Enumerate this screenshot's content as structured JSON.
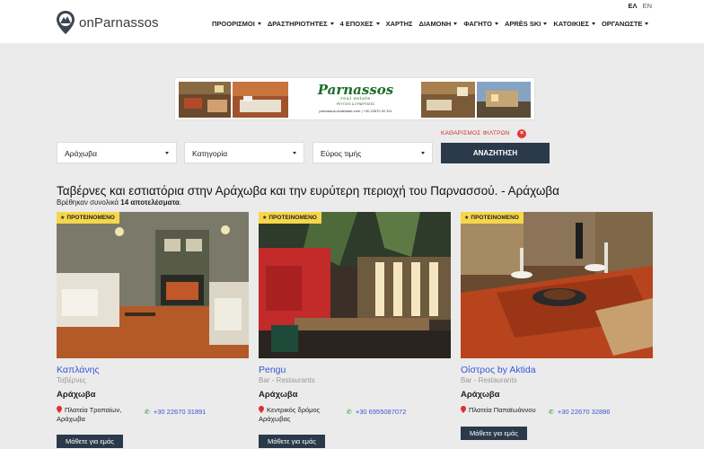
{
  "header": {
    "logo_text": "onParnassos",
    "lang": {
      "el": "ΕΛ",
      "en": "EN"
    },
    "nav": [
      {
        "label": "ΠΡΟΟΡΙΣΜΟΙ",
        "dropdown": true
      },
      {
        "label": "ΔΡΑΣΤΗΡΙΟΤΗΤΕΣ",
        "dropdown": true
      },
      {
        "label": "4 ΕΠΟΧΕΣ",
        "dropdown": true
      },
      {
        "label": "ΧΑΡΤΗΣ",
        "dropdown": false
      },
      {
        "label": "ΔΙΑΜΟΝΗ",
        "dropdown": true
      },
      {
        "label": "ΦΑΓΗΤΟ",
        "dropdown": true
      },
      {
        "label": "APRÈS SKI",
        "dropdown": true
      },
      {
        "label": "ΚΑΤΟΙΚΙΕΣ",
        "dropdown": true
      },
      {
        "label": "ΟΡΓΑΝΩΣΤΕ",
        "dropdown": true
      }
    ]
  },
  "banner": {
    "title": "Parnassos",
    "subtitle": "real estate",
    "tagline": "ΡΕΥΓΟΥΣ & ΣΥΝΕΡΓΑΤΕΣ",
    "contact": "parnassos-realestate.com | +30 22670 32 311"
  },
  "filters": {
    "clear_label": "ΚΑΘΑΡΙΣΜΟΣ ΦΙΛΤΡΩΝ",
    "location": "Αράχωβα",
    "category": "Κατηγορία",
    "price": "Εύρος τιμής",
    "search_label": "ΑΝΑΖΗΤΗΣΗ"
  },
  "results": {
    "title": "Ταβέρνες και εστιατόρια στην Αράχωβα και την ευρύτερη περιοχή του Παρνασσού. - Αράχωβα",
    "found_prefix": "Βρέθηκαν συνολικά",
    "found_count": "14 αποτελέσματα",
    "found_suffix": "."
  },
  "cards": [
    {
      "badge": "ΠΡΟΤΕΙΝΟΜΕΝΟ",
      "name": "Καπλάνης",
      "category": "Ταβέρνες",
      "town": "Αράχωβα",
      "address": "Πλατεία Τροπαίων, Αράχωβα",
      "phone": "+30 22670 31891",
      "button": "Μάθετε για εμάς"
    },
    {
      "badge": "ΠΡΟΤΕΙΝΟΜΕΝΟ",
      "name": "Pengu",
      "category": "Bar - Restaurants",
      "town": "Αράχωβα",
      "address": "Κεντρικός δρόμος Αράχωβας",
      "phone": "+30 6955087072",
      "button": "Μάθετε για εμάς"
    },
    {
      "badge": "ΠΡΟΤΕΙΝΟΜΕΝΟ",
      "name": "Οίστρος by Aktida",
      "category": "Bar - Restaurants",
      "town": "Αράχωβα",
      "address": "Πλατεία Παπαϊωάννου",
      "phone": "+30 22670 32886",
      "button": "Μάθετε για εμάς"
    }
  ]
}
